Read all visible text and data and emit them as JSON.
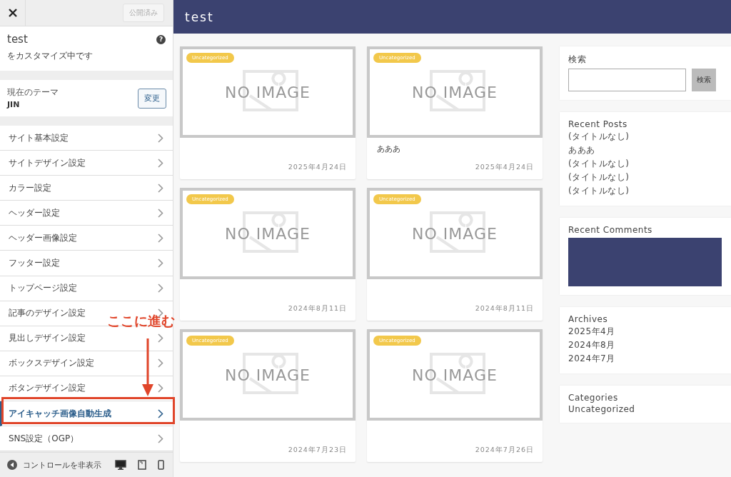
{
  "customizer": {
    "publish_button": "公開済み",
    "site_title": "test",
    "subtitle": "をカスタマイズ中です",
    "help": "?",
    "theme_label": "現在のテーマ",
    "theme_name": "JIN",
    "change_button": "変更",
    "menu": [
      {
        "label": "サイト基本設定",
        "selected": false
      },
      {
        "label": "サイトデザイン設定",
        "selected": false
      },
      {
        "label": "カラー設定",
        "selected": false
      },
      {
        "label": "ヘッダー設定",
        "selected": false
      },
      {
        "label": "ヘッダー画像設定",
        "selected": false
      },
      {
        "label": "フッター設定",
        "selected": false
      },
      {
        "label": "トップページ設定",
        "selected": false
      },
      {
        "label": "記事のデザイン設定",
        "selected": false
      },
      {
        "label": "見出しデザイン設定",
        "selected": false
      },
      {
        "label": "ボックスデザイン設定",
        "selected": false
      },
      {
        "label": "ボタンデザイン設定",
        "selected": false
      },
      {
        "label": "アイキャッチ画像自動生成",
        "selected": true
      },
      {
        "label": "SNS設定（OGP）",
        "selected": false
      }
    ],
    "hide_controls": "コントロールを非表示",
    "devices": [
      {
        "kind": "desktop",
        "selected": true
      },
      {
        "kind": "tablet",
        "selected": false
      },
      {
        "kind": "mobile",
        "selected": false
      }
    ]
  },
  "annotation": {
    "text": "ここに進む"
  },
  "preview": {
    "site_title": "test",
    "posts": [
      {
        "category": "Uncategorized",
        "placeholder": "NO IMAGE",
        "date": "2025年4月24日"
      },
      {
        "category": "Uncategorized",
        "placeholder": "NO IMAGE",
        "title": "あああ",
        "date": "2025年4月24日"
      },
      {
        "category": "Uncategorized",
        "placeholder": "NO IMAGE",
        "date": "2024年8月11日"
      },
      {
        "category": "Uncategorized",
        "placeholder": "NO IMAGE",
        "date": "2024年8月11日"
      },
      {
        "category": "Uncategorized",
        "placeholder": "NO IMAGE",
        "date": "2024年7月23日"
      },
      {
        "category": "Uncategorized",
        "placeholder": "NO IMAGE",
        "date": "2024年7月26日"
      }
    ],
    "search": {
      "title": "検索",
      "button": "検索"
    },
    "recent_posts": {
      "title": "Recent Posts",
      "items": [
        "(タイトルなし)",
        "あああ",
        "(タイトルなし)",
        "(タイトルなし)",
        "(タイトルなし)"
      ]
    },
    "recent_comments": {
      "title": "Recent Comments"
    },
    "archives": {
      "title": "Archives",
      "items": [
        "2025年4月",
        "2024年8月",
        "2024年7月"
      ]
    },
    "categories": {
      "title": "Categories",
      "items": [
        "Uncategorized"
      ]
    }
  }
}
